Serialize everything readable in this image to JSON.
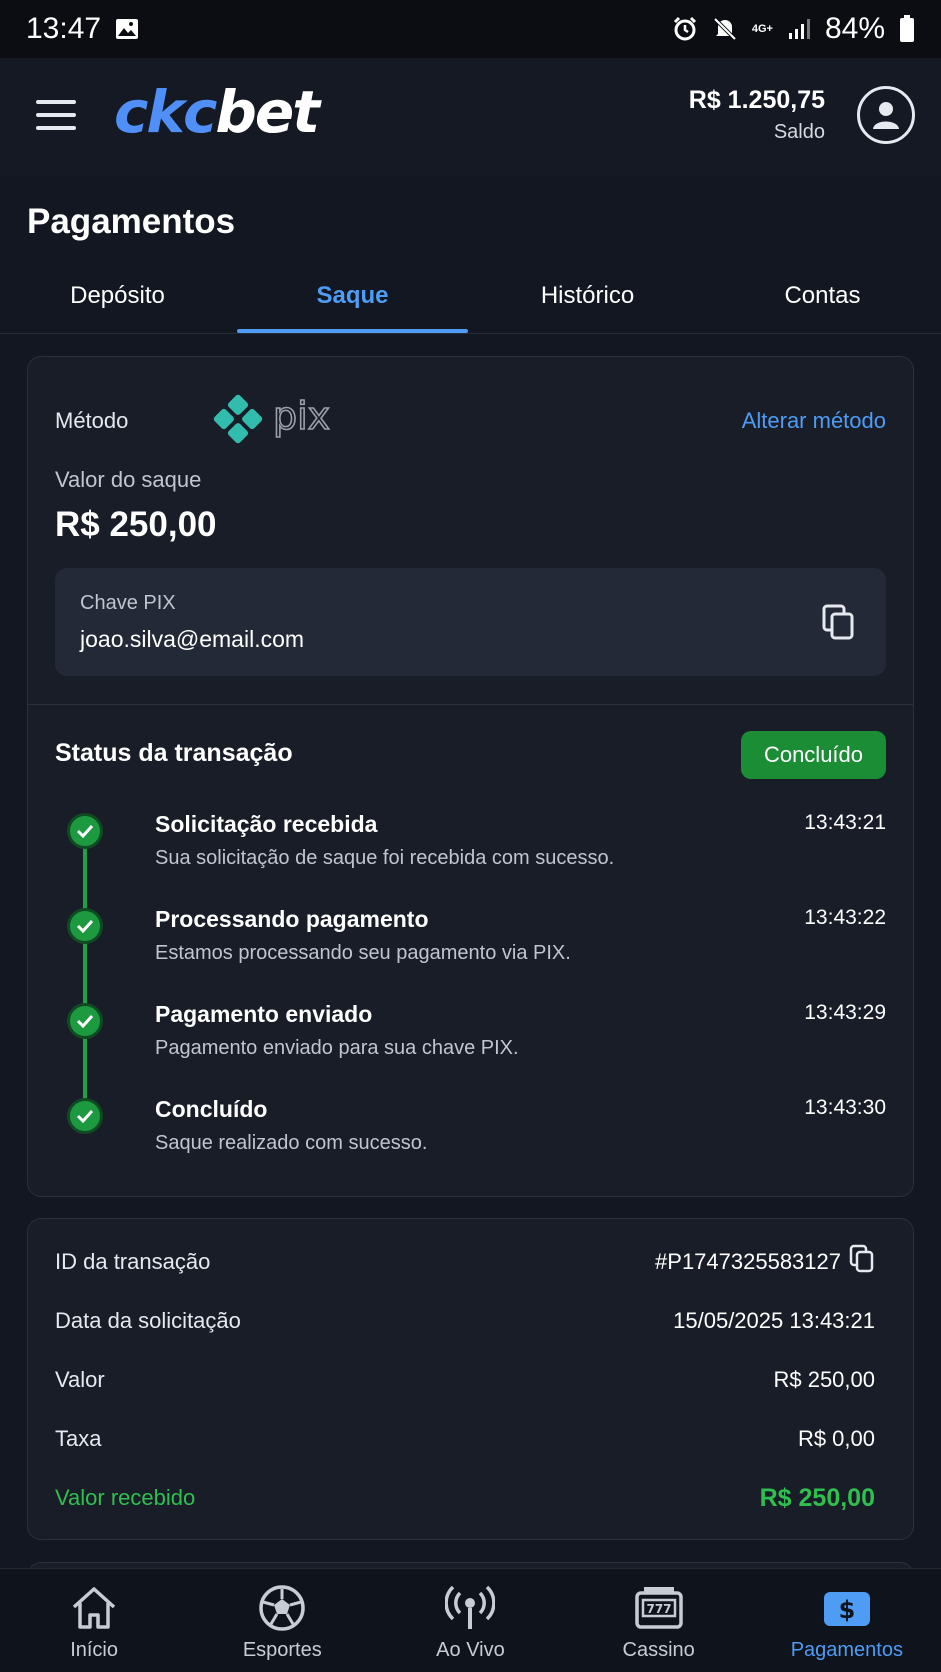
{
  "status_bar": {
    "time": "13:47",
    "network": "4G+",
    "battery": "84%"
  },
  "header": {
    "logo_part1": "ckc",
    "logo_part2": "bet",
    "balance_amount": "R$ 1.250,75",
    "balance_label": "Saldo"
  },
  "page": {
    "title": "Pagamentos"
  },
  "tabs": [
    {
      "label": "Depósito",
      "active": false
    },
    {
      "label": "Saque",
      "active": true
    },
    {
      "label": "Histórico",
      "active": false
    },
    {
      "label": "Contas",
      "active": false
    }
  ],
  "withdraw": {
    "method_label": "Método",
    "method_name": "pix",
    "change_method": "Alterar método",
    "amount_label": "Valor do saque",
    "amount": "R$ 250,00",
    "pix_key_label": "Chave PIX",
    "pix_key_value": "joao.silva@email.com"
  },
  "status": {
    "title": "Status da transação",
    "badge": "Concluído",
    "badge_color": "#1a8d35",
    "steps": [
      {
        "title": "Solicitação recebida",
        "desc": "Sua solicitação de saque foi recebida com sucesso.",
        "time": "13:43:21"
      },
      {
        "title": "Processando pagamento",
        "desc": "Estamos processando seu pagamento via PIX.",
        "time": "13:43:22"
      },
      {
        "title": "Pagamento enviado",
        "desc": "Pagamento enviado para sua chave PIX.",
        "time": "13:43:29"
      },
      {
        "title": "Concluído",
        "desc": "Saque realizado com sucesso.",
        "time": "13:43:30"
      }
    ]
  },
  "details": {
    "transaction_id_label": "ID da transação",
    "transaction_id": "#P1747325583127",
    "request_date_label": "Data da solicitação",
    "request_date": "15/05/2025 13:43:21",
    "value_label": "Valor",
    "value": "R$ 250,00",
    "fee_label": "Taxa",
    "fee": "R$ 0,00",
    "received_label": "Valor recebido",
    "received": "R$ 250,00"
  },
  "bottom_nav": [
    {
      "label": "Início",
      "icon": "home-icon",
      "active": false
    },
    {
      "label": "Esportes",
      "icon": "soccer-ball-icon",
      "active": false
    },
    {
      "label": "Ao Vivo",
      "icon": "live-antenna-icon",
      "active": false
    },
    {
      "label": "Cassino",
      "icon": "slot-machine-icon",
      "active": false
    },
    {
      "label": "Pagamentos",
      "icon": "dollar-icon",
      "active": true
    }
  ],
  "colors": {
    "accent": "#4f9cf5",
    "success": "#2fbf4f",
    "background": "#121721",
    "card": "#181d27"
  }
}
